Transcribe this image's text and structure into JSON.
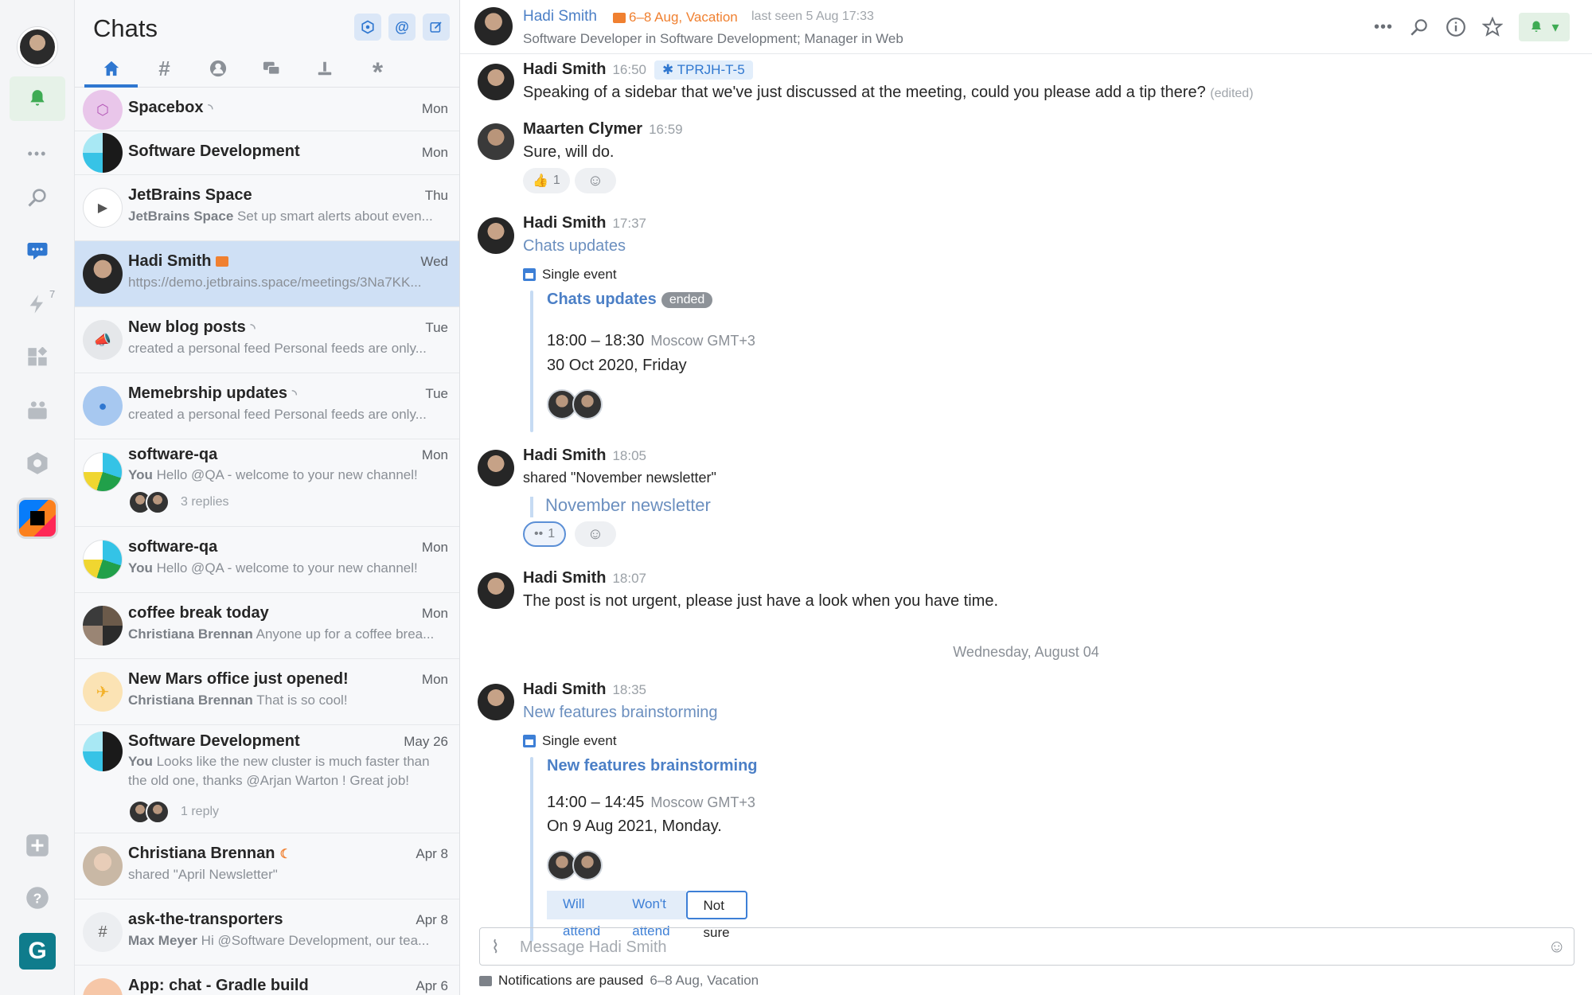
{
  "sidebar": {
    "more": "•••",
    "badge": "7"
  },
  "chats": {
    "title": "Chats",
    "tabs": [
      "home",
      "channels",
      "people",
      "conversations",
      "apps",
      "other"
    ],
    "items": [
      {
        "name": "Spacebox",
        "date": "Mon",
        "preview_author": "",
        "preview": "",
        "feed": true
      },
      {
        "name": "Software Development",
        "date": "Mon",
        "preview_author": "",
        "preview": ""
      },
      {
        "name": "JetBrains Space",
        "date": "Thu",
        "preview_author": "JetBrains Space",
        "preview": "Set up smart alerts about even..."
      },
      {
        "name": "Hadi Smith",
        "date": "Wed",
        "preview_author": "",
        "preview": "https://demo.jetbrains.space/meetings/3Na7KK..."
      },
      {
        "name": "New blog posts",
        "date": "Tue",
        "preview_author": "",
        "preview": "created a personal feed Personal feeds are only..."
      },
      {
        "name": "Memebrship updates",
        "date": "Tue",
        "preview_author": "",
        "preview": "created a personal feed Personal feeds are only..."
      },
      {
        "name": "software-qa",
        "date": "Mon",
        "preview_author": "You",
        "preview": "Hello @QA - welcome to your new channel!",
        "replies": "3 replies"
      },
      {
        "name": "software-qa",
        "date": "Mon",
        "preview_author": "You",
        "preview": "Hello @QA - welcome to your new channel!"
      },
      {
        "name": "coffee break today",
        "date": "Mon",
        "preview_author": "Christiana Brennan",
        "preview": "Anyone up for a coffee brea..."
      },
      {
        "name": "New Mars office just opened!",
        "date": "Mon",
        "preview_author": "Christiana Brennan",
        "preview": "That is so cool!"
      },
      {
        "name": "Software Development",
        "date": "May 26",
        "preview_author": "You",
        "preview": "Looks like the new cluster is much faster than the old one, thanks @Arjan Warton ! Great job!",
        "replies": "1 reply"
      },
      {
        "name": "Christiana Brennan",
        "date": "Apr 8",
        "preview_author": "",
        "preview": "shared \"April Newsletter\""
      },
      {
        "name": "ask-the-transporters",
        "date": "Apr 8",
        "preview_author": "Max Meyer",
        "preview": "Hi @Software Development, our tea..."
      },
      {
        "name": "App: chat - Gradle build",
        "date": "Apr 6",
        "preview_author": "",
        "preview": ""
      }
    ]
  },
  "header": {
    "name": "Hadi Smith",
    "vacation": "6–8 Aug, Vacation",
    "last_seen": "last seen 5 Aug 17:33",
    "role": "Software Developer in Software Development; Manager in Web"
  },
  "messages": [
    {
      "author": "Hadi Smith",
      "time": "16:50",
      "tag": "TPRJH-T-5",
      "text": "Speaking of a sidebar that we've just discussed at the meeting, could you please add a tip there?",
      "edited": "(edited)"
    },
    {
      "author": "Maarten Clymer",
      "time": "16:59",
      "text": "Sure, will do.",
      "reaction_count": "1"
    },
    {
      "author": "Hadi Smith",
      "time": "17:37",
      "link": "Chats updates",
      "event": {
        "kind": "Single event",
        "title": "Chats updates",
        "status": "ended",
        "time": "18:00 – 18:30",
        "tz": "Moscow GMT+3",
        "date": "30 Oct 2020, Friday"
      }
    },
    {
      "author": "Hadi Smith",
      "time": "18:05",
      "text": "shared \"November newsletter\"",
      "shared_title": "November newsletter",
      "reaction_count": "1"
    },
    {
      "author": "Hadi Smith",
      "time": "18:07",
      "text": "The post is not urgent, please just have a look when you have time."
    },
    {
      "author": "Hadi Smith",
      "time": "18:35",
      "link": "New features brainstorming",
      "event": {
        "kind": "Single event",
        "title": "New features brainstorming",
        "time": "14:00 – 14:45",
        "tz": "Moscow GMT+3",
        "date": "On 9 Aug 2021, Monday.",
        "rsvp": [
          "Will attend",
          "Won't attend",
          "Not sure"
        ]
      }
    }
  ],
  "day_separator": "Wednesday, August 04",
  "composer": {
    "placeholder": "Message Hadi Smith"
  },
  "status_bar": {
    "text": "Notifications are paused",
    "dates": "6–8 Aug, Vacation"
  }
}
